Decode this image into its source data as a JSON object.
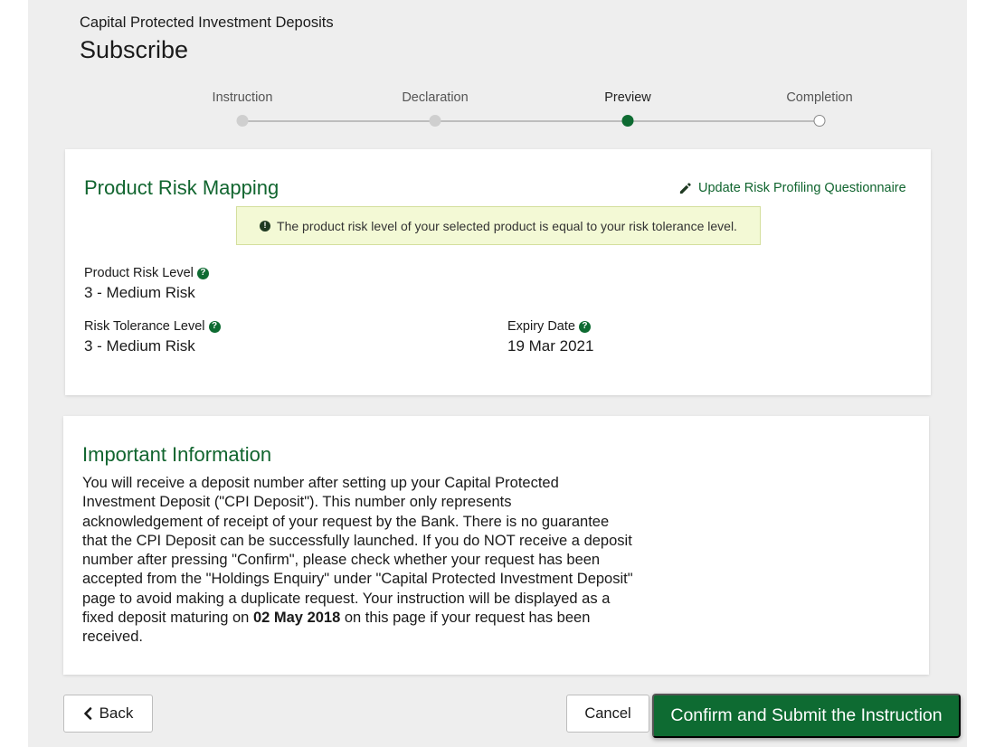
{
  "header": {
    "subtitle": "Capital Protected Investment Deposits",
    "title": "Subscribe"
  },
  "stepper": {
    "steps": [
      {
        "label": "Instruction",
        "state": "done"
      },
      {
        "label": "Declaration",
        "state": "done"
      },
      {
        "label": "Preview",
        "state": "active"
      },
      {
        "label": "Completion",
        "state": "todo"
      }
    ]
  },
  "risk_mapping": {
    "title": "Product Risk Mapping",
    "update_link": "Update Risk Profiling Questionnaire",
    "notice": "The product risk level of your selected product is equal to your risk tolerance level.",
    "product_risk_label": "Product Risk Level",
    "product_risk_value": "3 - Medium Risk",
    "risk_tolerance_label": "Risk Tolerance Level",
    "risk_tolerance_value": "3 - Medium Risk",
    "expiry_label": "Expiry Date",
    "expiry_value": "19 Mar 2021"
  },
  "important_info": {
    "title": "Important Information",
    "text_before": "You will receive a deposit number after setting up your Capital Protected Investment Deposit (\"CPI Deposit\"). This number only represents acknowledgement of receipt of your request by the Bank. There is no guarantee that the CPI Deposit can be successfully launched. If you do NOT receive a deposit number after pressing \"Confirm\", please check whether your request has been accepted from the \"Holdings Enquiry\" under \"Capital Protected Investment Deposit\" page to avoid making a duplicate request. Your instruction will be displayed as a fixed deposit maturing on ",
    "maturity_date": "02 May 2018",
    "text_after": " on this page if your request has been received."
  },
  "actions": {
    "back_label": "Back",
    "cancel_label": "Cancel",
    "confirm_label": "Confirm and Submit the Instruction"
  },
  "colors": {
    "brand_green": "#0e6b32",
    "notice_bg": "#f3f9d5",
    "page_bg": "#eeeeee"
  }
}
